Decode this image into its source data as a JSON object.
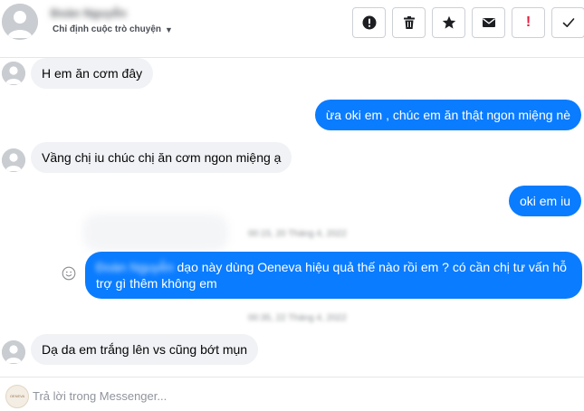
{
  "header": {
    "contact_name": "Đoàn Nguyễn",
    "assign_label": "Chỉ định cuộc trò chuyện",
    "toolbar": [
      {
        "name": "spam-button",
        "icon": "exclamation-circle-icon"
      },
      {
        "name": "delete-button",
        "icon": "trash-icon"
      },
      {
        "name": "star-button",
        "icon": "star-icon"
      },
      {
        "name": "mark-unread-button",
        "icon": "envelope-icon"
      },
      {
        "name": "follow-up-button",
        "icon": "exclamation-red-icon"
      },
      {
        "name": "mark-done-button",
        "icon": "checkmark-icon"
      }
    ]
  },
  "messages": [
    {
      "direction": "incoming",
      "text": "H em ăn cơm đây"
    },
    {
      "direction": "outgoing",
      "text": "ừa oki em , chúc em ăn thật ngon miệng nè"
    },
    {
      "direction": "incoming",
      "text": "Vầng chị iu chúc chị ăn cơm ngon miệng ạ"
    },
    {
      "direction": "outgoing",
      "text": "oki em  iu"
    },
    {
      "direction": "outgoing",
      "sender": "Đoàn Nguyễn",
      "text": "dạo này dùng Oeneva hiệu quả thế nào rồi em ? có cần chị tư vấn hỗ trợ gì thêm không em"
    },
    {
      "direction": "incoming",
      "text": "Dạ da em trắng lên vs cũng bớt mụn"
    }
  ],
  "timestamps": [
    "00:15, 20 Tháng 4, 2022",
    "00:35, 22 Tháng 4, 2022"
  ],
  "reply": {
    "placeholder": "Trả lời trong Messenger...",
    "logo_text": "OENEVA"
  },
  "colors": {
    "outgoing_bubble": "#0a7cff",
    "incoming_bubble": "#f0f2f5",
    "flag_red": "#e41e3f"
  }
}
